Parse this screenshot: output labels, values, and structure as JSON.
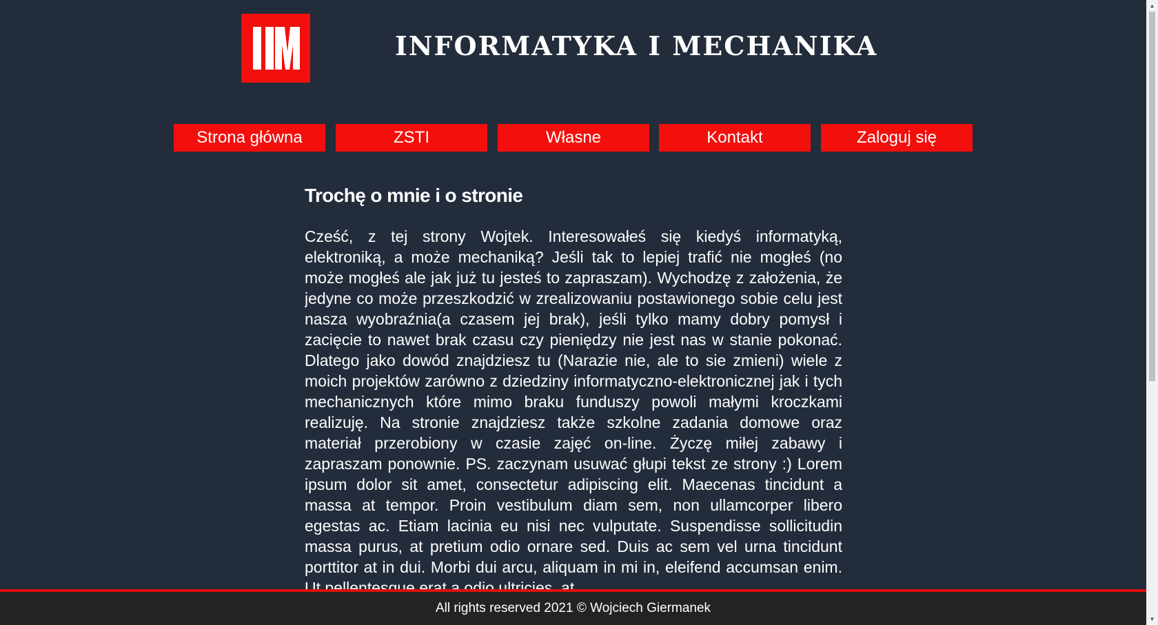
{
  "header": {
    "title": "INFORMATYKA I MECHANIKA",
    "logo_text": "IM",
    "logo_color": "#f20f0c"
  },
  "nav": {
    "items": [
      {
        "label": "Strona główna"
      },
      {
        "label": "ZSTI"
      },
      {
        "label": "Własne"
      },
      {
        "label": "Kontakt"
      },
      {
        "label": "Zaloguj się"
      }
    ]
  },
  "main": {
    "heading": "Trochę o mnie i o stronie",
    "body": "Cześć, z tej strony Wojtek. Interesowałeś się kiedyś informatyką, elektroniką, a może mechaniką? Jeśli tak to lepiej trafić nie mogłeś (no może mogłeś ale jak już tu jesteś to zapraszam). Wychodzę z założenia, że jedyne co może przeszkodzić w zrealizowaniu postawionego sobie celu jest nasza wyobraźnia(a czasem jej brak), jeśli tylko mamy dobry pomysł i zacięcie to nawet brak czasu czy pieniędzy nie jest nas w stanie pokonać. Dlatego jako dowód znajdziesz tu (Narazie nie, ale to sie zmieni) wiele z moich projektów zarówno z dziedziny informatyczno-elektronicznej jak i tych mechanicznych które mimo braku funduszy powoli małymi kroczkami realizuję. Na stronie znajdziesz także szkolne zadania domowe oraz materiał przerobiony w czasie zajęć on-line. Życzę miłej zabawy i zapraszam ponownie. PS. zaczynam usuwać głupi tekst ze strony :) Lorem ipsum dolor sit amet, consectetur adipiscing elit. Maecenas tincidunt a massa at tempor. Proin vestibulum diam sem, non ullamcorper libero egestas ac. Etiam lacinia eu nisi nec vulputate. Suspendisse sollicitudin massa purus, at pretium odio ornare sed. Duis ac sem vel urna tincidunt porttitor at in dui. Morbi dui arcu, aliquam in mi in, eleifend accumsan enim. Ut pellentesque erat a odio ultricies, at"
  },
  "footer": {
    "text": "All rights reserved 2021 © Wojciech Giermanek"
  },
  "colors": {
    "background": "#232c3b",
    "accent": "#f20f0c",
    "footer_bg": "#232323"
  }
}
